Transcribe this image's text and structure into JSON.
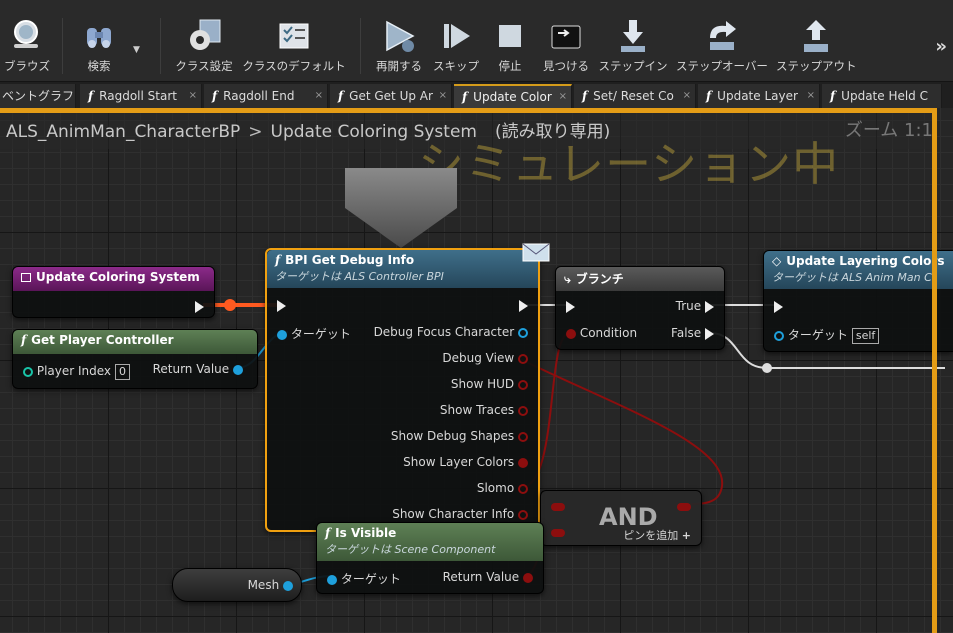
{
  "toolbar": {
    "buttons": [
      {
        "label": "ブラウズ",
        "icon": "browse-icon"
      },
      {
        "label": "検索",
        "icon": "binoculars-icon"
      },
      {
        "label": "クラス設定",
        "icon": "gear-icon"
      },
      {
        "label": "クラスのデフォルト",
        "icon": "checklist-icon"
      },
      {
        "label": "再開する",
        "icon": "resume-icon"
      },
      {
        "label": "スキップ",
        "icon": "skip-icon"
      },
      {
        "label": "停止",
        "icon": "stop-icon"
      },
      {
        "label": "見つける",
        "icon": "find-icon"
      },
      {
        "label": "ステップイン",
        "icon": "step-in-icon"
      },
      {
        "label": "ステップオーバー",
        "icon": "step-over-icon"
      },
      {
        "label": "ステップアウト",
        "icon": "step-out-icon"
      }
    ],
    "more": "»"
  },
  "tabs": [
    {
      "label": "ベントグラフ",
      "f": false
    },
    {
      "label": "Ragdoll Start",
      "f": true
    },
    {
      "label": "Ragdoll End",
      "f": true
    },
    {
      "label": "Get Get Up Ar",
      "f": true
    },
    {
      "label": "Update Color",
      "f": true
    },
    {
      "label": "Set/ Reset Co",
      "f": true
    },
    {
      "label": "Update Layer",
      "f": true
    },
    {
      "label": "Update Held C",
      "f": true
    }
  ],
  "tab_close": "×",
  "breadcrumb": {
    "blueprint": "ALS_AnimMan_CharacterBP",
    "separator": ">",
    "graph": "Update Coloring System",
    "readonly": "(読み取り専用)"
  },
  "zoom_label": "ズーム 1:1",
  "simulation_banner": "シミュレーション中",
  "nodes": {
    "entry": {
      "title": "Update Coloring System"
    },
    "get_player_controller": {
      "title": "Get Player Controller",
      "pin_in": "Player Index",
      "pin_in_value": "0",
      "pin_out": "Return Value"
    },
    "bpi": {
      "title": "BPI Get Debug Info",
      "subtitle": "ターゲットは ALS Controller BPI",
      "pin_target": "ターゲット",
      "outputs": [
        "Debug Focus Character",
        "Debug View",
        "Show HUD",
        "Show Traces",
        "Show Debug Shapes",
        "Show Layer Colors",
        "Slomo",
        "Show Character Info"
      ]
    },
    "branch": {
      "title": "ブランチ",
      "pin_condition": "Condition",
      "pin_true": "True",
      "pin_false": "False"
    },
    "update_layering": {
      "title": "Update Layering Colors",
      "subtitle": "ターゲットは ALS Anim Man C",
      "pin_target": "ターゲット",
      "pin_target_value": "self"
    },
    "and": {
      "title": "AND",
      "add_pin": "ピンを追加"
    },
    "is_visible": {
      "title": "Is Visible",
      "subtitle": "ターゲットは Scene Component",
      "pin_target": "ターゲット",
      "pin_out": "Return Value"
    },
    "mesh": {
      "label": "Mesh"
    }
  },
  "colors": {
    "accent": "#e39c16",
    "exec": "#eeeeee",
    "object_pin": "#1ea0dc",
    "bool_pin": "#8c0e0e",
    "event_header": "#7a1e78",
    "pure_header": "#4f6e47",
    "func_header": "#3d6b85"
  }
}
